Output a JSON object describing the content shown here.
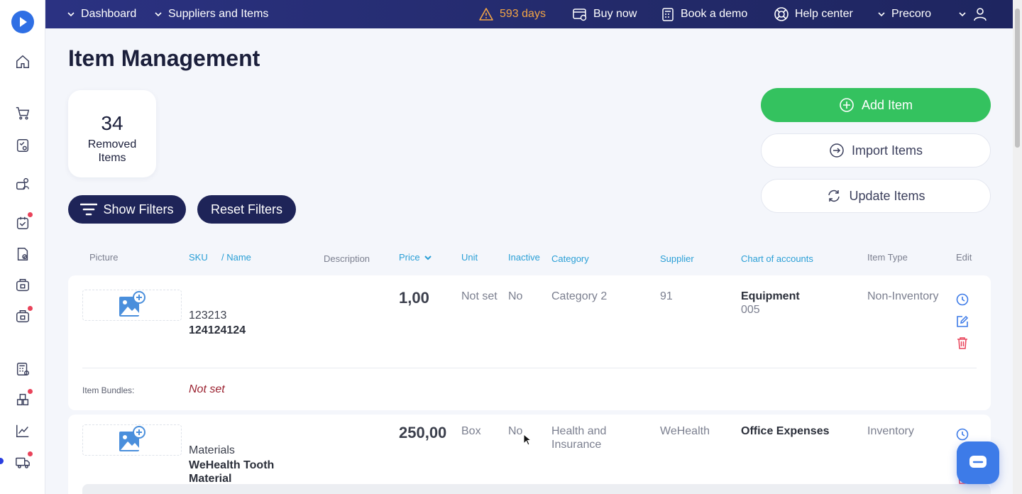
{
  "topbar": {
    "breadcrumb_dashboard": "Dashboard",
    "breadcrumb_suppliers": "Suppliers and Items",
    "trial_days": "593 days",
    "buy_now": "Buy now",
    "book_demo": "Book a demo",
    "help_center": "Help center",
    "company": "Precoro"
  },
  "page": {
    "title": "Item Management",
    "removed_count": "34",
    "removed_label_line1": "Removed",
    "removed_label_line2": "Items",
    "show_filters": "Show Filters",
    "reset_filters": "Reset Filters",
    "add_item": "Add Item",
    "import_items": "Import Items",
    "update_items": "Update Items"
  },
  "table": {
    "headers": {
      "picture": "Picture",
      "sku": "SKU",
      "name": "/ Name",
      "description": "Description",
      "price": "Price",
      "unit": "Unit",
      "inactive": "Inactive",
      "category": "Category",
      "supplier": "Supplier",
      "chart_of_accounts": "Chart of accounts",
      "item_type": "Item Type",
      "edit": "Edit"
    },
    "rows": [
      {
        "sku": "123213",
        "name": "124124124",
        "price": "1,00",
        "unit": "Not set",
        "inactive": "No",
        "category": "Category 2",
        "supplier": "91",
        "account_name": "Equipment",
        "account_code": "005",
        "item_type": "Non-Inventory",
        "bundles_label": "Item Bundles:",
        "bundles_value": "Not set"
      },
      {
        "sku": "Materials",
        "name_line1": "WeHealth Tooth",
        "name_line2": "Material",
        "price": "250,00",
        "unit": "Box",
        "inactive": "No",
        "category_line1": "Health and",
        "category_line2": "Insurance",
        "supplier": "WeHealth",
        "account_name": "Office Expenses",
        "item_type": "Inventory"
      }
    ]
  },
  "colors": {
    "topbar": "#232a6a",
    "accent_green": "#34c25f",
    "header_blue": "#2a9fd6",
    "dark_pill": "#1e2458",
    "delete_red": "#e9435a",
    "chat_blue": "#3d7be8"
  }
}
